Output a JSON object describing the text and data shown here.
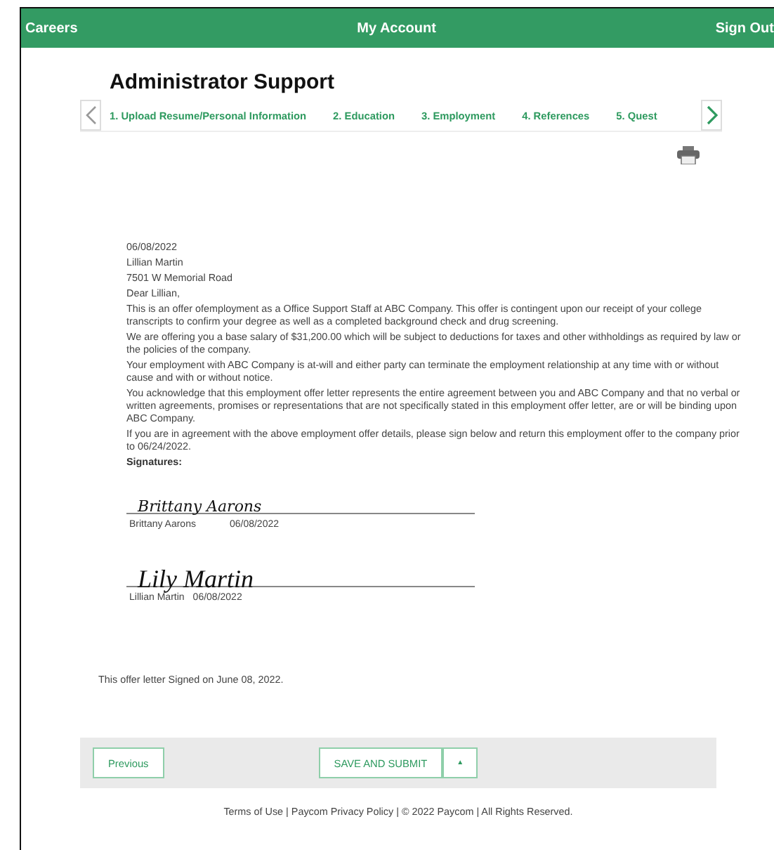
{
  "top_bar": {
    "left": "Careers",
    "center": "My Account",
    "right": "Sign Out"
  },
  "title": "Administrator Support",
  "steps": [
    "1. Upload Resume/Personal Information",
    "2. Education",
    "3. Employment",
    "4. References",
    "5. Quest"
  ],
  "letter": {
    "lines": [
      "06/08/2022",
      "Lillian Martin",
      "7501 W Memorial Road",
      "Dear Lillian,"
    ],
    "paragraphs": [
      "This is an offer ofemployment as a Office Support Staff at ABC Company. This offer is contingent upon our receipt of your college transcripts to confirm your degree as well as a completed background check and drug screening.",
      "We are offering you a base salary of $31,200.00 which will be subject to deductions for taxes and other withholdings as required by law or the policies of the company.",
      "Your employment with ABC Company is at-will and either party can terminate the employment relationship at any time with or without cause and with or without notice.",
      "You acknowledge that this employment offer letter represents the entire agreement between you and ABC Company and that no verbal or written agreements, promises or representations that are not specifically stated in this employment offer letter, are or will be binding upon ABC Company.",
      "If you are in agreement with the above employment offer details, please sign below and return this employment offer to the company prior to 06/24/2022."
    ],
    "signatures_heading": "Signatures:",
    "signatures": [
      {
        "kind": "print",
        "signature": "Brittany Aarons",
        "name": "Brittany Aarons",
        "date": "06/08/2022"
      },
      {
        "kind": "script",
        "signature": "Lily Martin",
        "name": "Lillian Martin",
        "date": "06/08/2022"
      }
    ],
    "signed_note": "This offer letter Signed on June 08, 2022."
  },
  "buttons": {
    "previous": "Previous",
    "submit": "SAVE AND SUBMIT",
    "caret": "▲"
  },
  "footer": "Terms of Use | Paycom Privacy Policy | © 2022 Paycom | All Rights Reserved."
}
